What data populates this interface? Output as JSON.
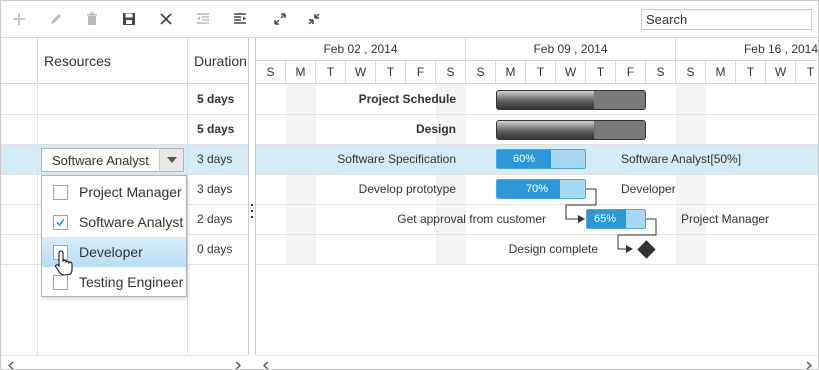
{
  "toolbar": {
    "buttons": [
      {
        "name": "add-button",
        "icon": "plus-icon",
        "enabled": false
      },
      {
        "name": "edit-button",
        "icon": "pencil-icon",
        "enabled": false
      },
      {
        "name": "delete-button",
        "icon": "trash-icon",
        "enabled": false
      },
      {
        "name": "update-button",
        "icon": "save-icon",
        "enabled": true
      },
      {
        "name": "cancel-button",
        "icon": "close-icon",
        "enabled": true
      },
      {
        "name": "outdent-button",
        "icon": "outdent-icon",
        "enabled": false
      },
      {
        "name": "indent-button",
        "icon": "indent-icon",
        "enabled": true
      },
      {
        "name": "expand-all-button",
        "icon": "expand-icon",
        "enabled": true
      },
      {
        "name": "collapse-all-button",
        "icon": "collapse-icon",
        "enabled": true
      }
    ],
    "search_placeholder": "Search"
  },
  "grid": {
    "columns": [
      "Resources",
      "Duration"
    ],
    "rows": [
      {
        "resources": "",
        "duration": "5 days",
        "bold": true
      },
      {
        "resources": "",
        "duration": "5 days",
        "bold": true
      },
      {
        "resources": "",
        "duration": "3 days",
        "bold": false,
        "selected": true
      },
      {
        "resources": "",
        "duration": "3 days",
        "bold": false
      },
      {
        "resources": "",
        "duration": "2 days",
        "bold": false
      },
      {
        "resources": "",
        "duration": "0 days",
        "bold": false
      }
    ]
  },
  "resource_editor": {
    "value": "Software Analyst",
    "options": [
      {
        "label": "Project Manager",
        "checked": false
      },
      {
        "label": "Software Analyst",
        "checked": true
      },
      {
        "label": "Developer",
        "checked": false,
        "hovered": true
      },
      {
        "label": "Testing Engineer",
        "checked": false
      }
    ]
  },
  "timeline": {
    "weeks": [
      "Feb 02 , 2014",
      "Feb 09 , 2014",
      "Feb 16 , 2014"
    ],
    "days": [
      "S",
      "M",
      "T",
      "W",
      "T",
      "F",
      "S",
      "S",
      "M",
      "T",
      "W",
      "T",
      "F",
      "S",
      "S",
      "M",
      "T",
      "W",
      "T"
    ]
  },
  "tasks": [
    {
      "name": "Project Schedule",
      "type": "parent",
      "resource": "",
      "progress": null
    },
    {
      "name": "Design",
      "type": "parent",
      "resource": "",
      "progress": null
    },
    {
      "name": "Software Specification",
      "type": "task",
      "resource": "Software Analyst[50%]",
      "progress": "60%"
    },
    {
      "name": "Develop prototype",
      "type": "task",
      "resource": "Developer",
      "progress": "70%"
    },
    {
      "name": "Get approval from customer",
      "type": "task",
      "resource": "Project Manager",
      "progress": "65%"
    },
    {
      "name": "Design complete",
      "type": "milestone",
      "resource": "",
      "progress": null
    }
  ],
  "colors": {
    "task_fill": "#2e97d8",
    "task_bg": "#a9d8f3",
    "selected_row": "#d4ebf8",
    "parent_bar": "#555555"
  }
}
